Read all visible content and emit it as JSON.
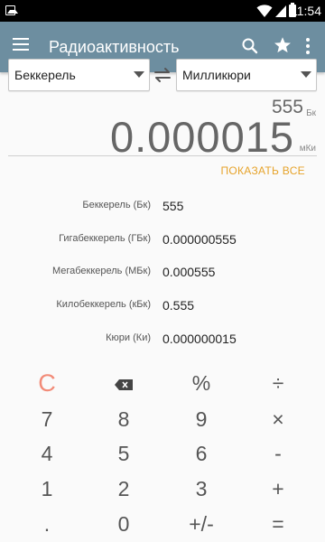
{
  "status_bar": {
    "time": "11:54"
  },
  "app_bar": {
    "title": "Радиоактивность"
  },
  "converter": {
    "from_unit": "Беккерель",
    "to_unit": "Милликюри",
    "source_value": "555",
    "source_unit": "Бк",
    "result_value": "0.000015",
    "result_unit": "мКи",
    "show_all_label": "ПОКАЗАТЬ ВСЕ"
  },
  "results": [
    {
      "name": "Беккерель (Бк)",
      "value": "555"
    },
    {
      "name": "Гигабеккерель (ГБк)",
      "value": "0.000000555"
    },
    {
      "name": "Мегабеккерель (МБк)",
      "value": "0.000555"
    },
    {
      "name": "Килобеккерель (кБк)",
      "value": "0.555"
    },
    {
      "name": "Кюри (Ки)",
      "value": "0.000000015"
    }
  ],
  "keypad": {
    "clear": "C",
    "percent": "%",
    "divide": "÷",
    "k7": "7",
    "k8": "8",
    "k9": "9",
    "multiply": "×",
    "k4": "4",
    "k5": "5",
    "k6": "6",
    "minus": "-",
    "k1": "1",
    "k2": "2",
    "k3": "3",
    "plus": "+",
    "dot": ".",
    "k0": "0",
    "negate": "+/-",
    "equals": "="
  },
  "colors": {
    "app_bar": "#6d8ea0",
    "accent": "#e6a32a",
    "clear": "#f28b78"
  }
}
